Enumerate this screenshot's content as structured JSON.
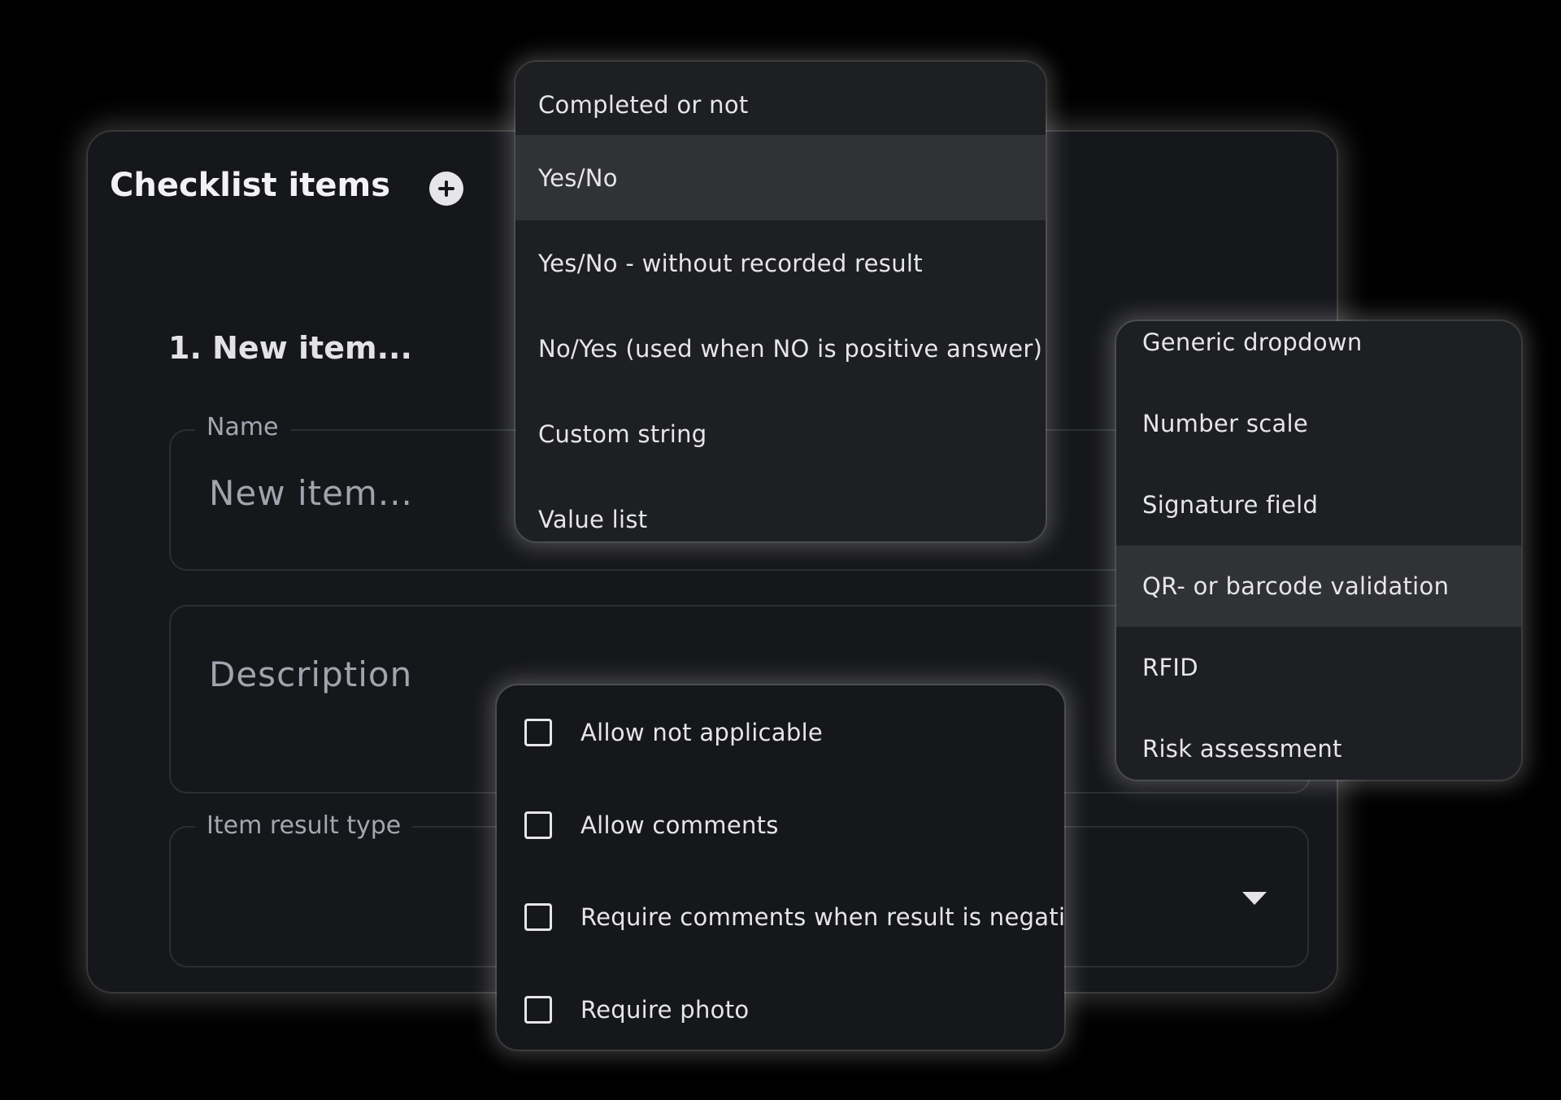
{
  "card": {
    "title": "Checklist items",
    "item_heading": "1. New item..."
  },
  "fields": {
    "name": {
      "label": "Name",
      "value": "New item..."
    },
    "description": {
      "placeholder": "Description"
    },
    "item_result_type": {
      "label": "Item result type",
      "value": ""
    }
  },
  "result_type_menu": {
    "items": [
      {
        "label": "Completed or not",
        "selected": false
      },
      {
        "label": "Yes/No",
        "selected": true
      },
      {
        "label": "Yes/No - without recorded result",
        "selected": false
      },
      {
        "label": "No/Yes (used when NO is positive answer)",
        "selected": false
      },
      {
        "label": "Custom string",
        "selected": false
      },
      {
        "label": "Value list",
        "selected": false
      }
    ]
  },
  "result_type_menu_more": {
    "items": [
      {
        "label": "Generic dropdown",
        "selected": false
      },
      {
        "label": "Number scale",
        "selected": false
      },
      {
        "label": "Signature field",
        "selected": false
      },
      {
        "label": "QR- or barcode validation",
        "selected": true
      },
      {
        "label": "RFID",
        "selected": false
      },
      {
        "label": "Risk assessment",
        "selected": false
      }
    ]
  },
  "options": {
    "items": [
      {
        "label": "Allow not applicable",
        "checked": false
      },
      {
        "label": "Allow comments",
        "checked": false
      },
      {
        "label": "Require comments when result is negative",
        "checked": false
      },
      {
        "label": "Require photo",
        "checked": false
      }
    ]
  },
  "icons": {
    "add": "plus-circle-icon",
    "dropdown": "caret-down-icon",
    "checkbox": "checkbox-empty-icon"
  },
  "colors": {
    "page_background": "#000000",
    "card_background": "#16171b",
    "menu_background": "#1e1f23",
    "selected_item": "#313236",
    "text_primary": "#e6e6e9",
    "text_muted": "#a0a4ad"
  }
}
